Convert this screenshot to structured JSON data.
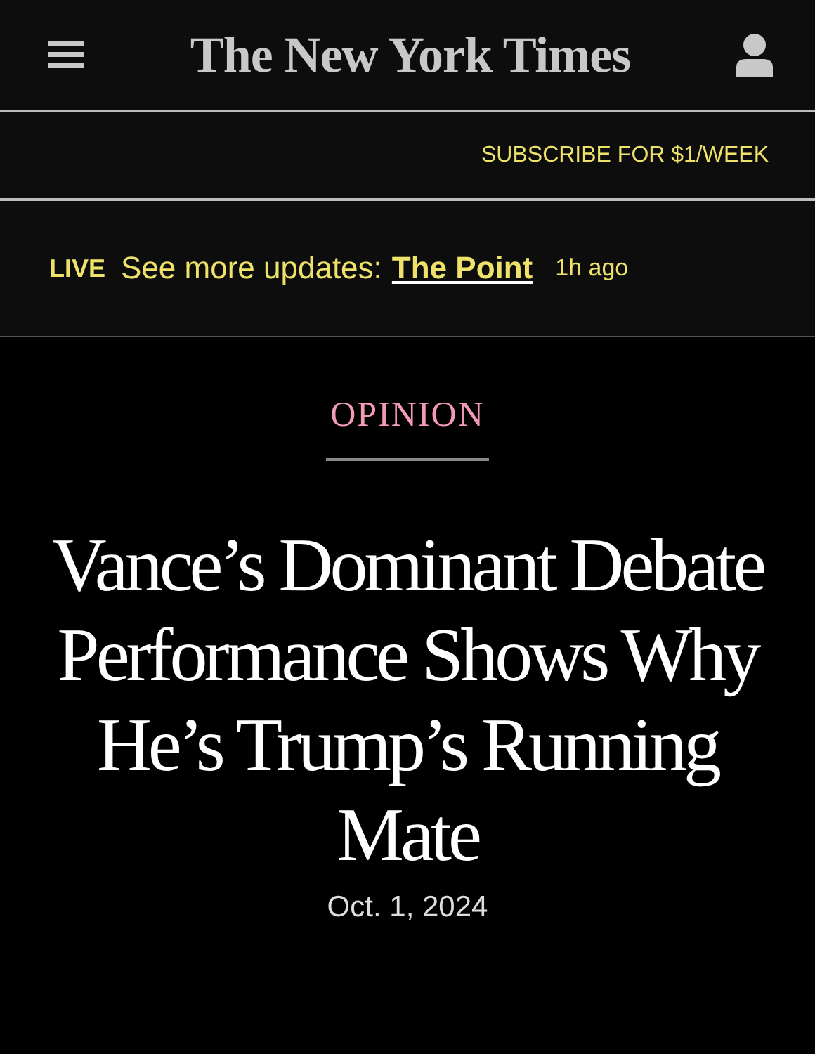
{
  "masthead": {
    "logo": "The New York Times"
  },
  "subscribe": {
    "label": "SUBSCRIBE FOR $1/WEEK"
  },
  "live_bar": {
    "badge": "LIVE",
    "text": "See more updates:",
    "link": "The Point",
    "time": "1h ago"
  },
  "article": {
    "section": "OPINION",
    "headline": "Vance’s Dominant Debate Performance Shows Why He’s Trump’s Running Mate",
    "date": "Oct. 1, 2024"
  }
}
